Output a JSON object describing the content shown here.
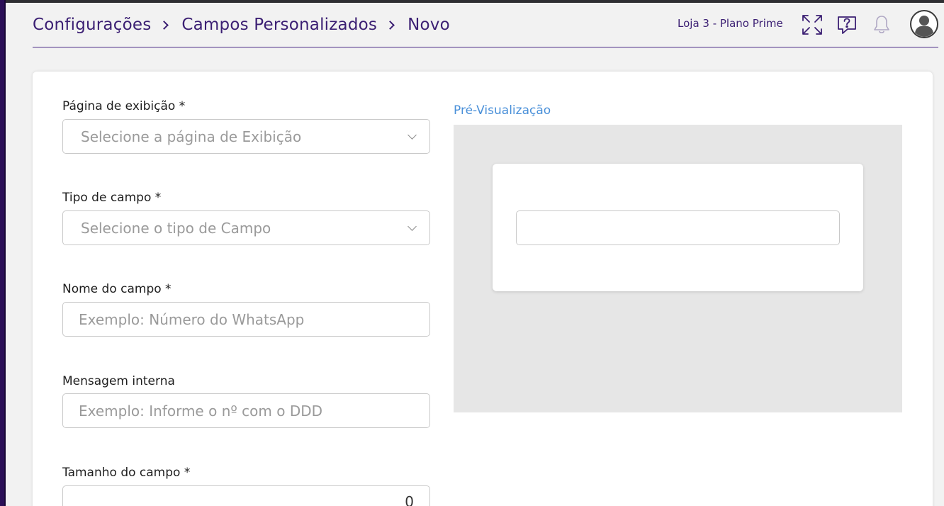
{
  "breadcrumb": {
    "items": [
      "Configurações",
      "Campos Personalizados",
      "Novo"
    ]
  },
  "header": {
    "store_label": "Loja 3 - Plano Prime",
    "icons": [
      "expand-icon",
      "help-chat-icon",
      "bell-icon",
      "user-avatar-icon"
    ]
  },
  "form": {
    "display_page": {
      "label": "Página de exibição *",
      "placeholder": "Selecione a página de Exibição"
    },
    "field_type": {
      "label": "Tipo de campo *",
      "placeholder": "Selecione o tipo de Campo"
    },
    "field_name": {
      "label": "Nome do campo *",
      "placeholder": "Exemplo: Número do WhatsApp"
    },
    "internal_message": {
      "label": "Mensagem interna",
      "placeholder": "Exemplo: Informe o nº com o DDD"
    },
    "field_size": {
      "label": "Tamanho do campo *",
      "value": "0"
    }
  },
  "preview": {
    "title": "Pré-Visualização"
  },
  "colors": {
    "brand": "#3b1f73",
    "link": "#4a90d9",
    "sidebar": "#2b0f57"
  }
}
